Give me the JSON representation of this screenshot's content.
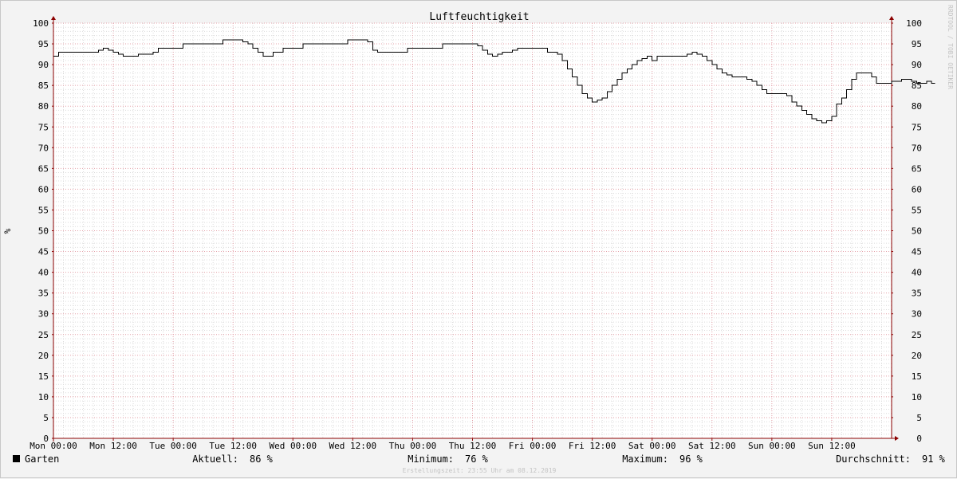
{
  "chart_data": {
    "type": "line",
    "title": "Luftfeuchtigkeit",
    "ylabel": "%",
    "ylim": [
      0,
      100
    ],
    "y_ticks": [
      0,
      5,
      10,
      15,
      20,
      25,
      30,
      35,
      40,
      45,
      50,
      55,
      60,
      65,
      70,
      75,
      80,
      85,
      90,
      95,
      100
    ],
    "x_ticks": [
      "Mon 00:00",
      "Mon 12:00",
      "Tue 00:00",
      "Tue 12:00",
      "Wed 00:00",
      "Wed 12:00",
      "Thu 00:00",
      "Thu 12:00",
      "Fri 00:00",
      "Fri 12:00",
      "Sat 00:00",
      "Sat 12:00",
      "Sun 00:00",
      "Sun 12:00"
    ],
    "xlim_hours": [
      0,
      168
    ],
    "grid": true,
    "line_style": "step",
    "watermark": "RRDTOOL / TOBI OETIKER",
    "series": [
      {
        "name": "Garten",
        "color": "#000000",
        "points": [
          [
            0,
            92
          ],
          [
            1,
            93
          ],
          [
            8,
            93
          ],
          [
            9,
            93.5
          ],
          [
            10,
            94
          ],
          [
            11,
            93.5
          ],
          [
            12,
            93
          ],
          [
            13,
            92.5
          ],
          [
            14,
            92
          ],
          [
            16,
            92
          ],
          [
            17,
            92.5
          ],
          [
            20,
            93
          ],
          [
            21,
            94
          ],
          [
            25,
            94
          ],
          [
            26,
            95
          ],
          [
            33,
            95
          ],
          [
            34,
            96
          ],
          [
            37,
            96
          ],
          [
            38,
            95.5
          ],
          [
            39,
            95
          ],
          [
            40,
            94
          ],
          [
            41,
            93
          ],
          [
            42,
            92
          ],
          [
            44,
            93
          ],
          [
            45,
            93
          ],
          [
            46,
            94
          ],
          [
            49,
            94
          ],
          [
            50,
            95
          ],
          [
            58,
            95
          ],
          [
            59,
            96
          ],
          [
            62,
            96
          ],
          [
            63,
            95.5
          ],
          [
            64,
            93.5
          ],
          [
            65,
            93
          ],
          [
            70,
            93
          ],
          [
            71,
            94
          ],
          [
            77,
            94
          ],
          [
            78,
            95
          ],
          [
            84,
            95
          ],
          [
            85,
            94.5
          ],
          [
            86,
            93.5
          ],
          [
            87,
            92.5
          ],
          [
            88,
            92
          ],
          [
            89,
            92.5
          ],
          [
            90,
            93
          ],
          [
            92,
            93.5
          ],
          [
            93,
            94
          ],
          [
            98,
            94
          ],
          [
            99,
            93
          ],
          [
            101,
            92.5
          ],
          [
            102,
            91
          ],
          [
            103,
            89
          ],
          [
            104,
            87
          ],
          [
            105,
            85
          ],
          [
            106,
            83
          ],
          [
            107,
            82
          ],
          [
            108,
            81
          ],
          [
            109,
            81.5
          ],
          [
            110,
            82
          ],
          [
            111,
            83.5
          ],
          [
            112,
            85
          ],
          [
            113,
            86.5
          ],
          [
            114,
            88
          ],
          [
            115,
            89
          ],
          [
            116,
            90
          ],
          [
            117,
            91
          ],
          [
            118,
            91.5
          ],
          [
            119,
            92
          ],
          [
            120,
            91
          ],
          [
            121,
            92
          ],
          [
            126,
            92
          ],
          [
            127,
            92.5
          ],
          [
            128,
            93
          ],
          [
            129,
            92.5
          ],
          [
            130,
            92
          ],
          [
            131,
            91
          ],
          [
            132,
            90
          ],
          [
            133,
            89
          ],
          [
            134,
            88
          ],
          [
            135,
            87.5
          ],
          [
            136,
            87
          ],
          [
            138,
            87
          ],
          [
            139,
            86.5
          ],
          [
            140,
            86
          ],
          [
            141,
            85
          ],
          [
            142,
            84
          ],
          [
            143,
            83
          ],
          [
            146,
            83
          ],
          [
            147,
            82.5
          ],
          [
            148,
            81
          ],
          [
            149,
            80
          ],
          [
            150,
            79
          ],
          [
            151,
            78
          ],
          [
            152,
            77
          ],
          [
            153,
            76.5
          ],
          [
            154,
            76
          ],
          [
            155,
            76.5
          ],
          [
            156,
            77.5
          ],
          [
            157,
            80.5
          ],
          [
            158,
            82
          ],
          [
            159,
            84
          ],
          [
            160,
            86.5
          ],
          [
            161,
            88
          ],
          [
            163,
            88
          ],
          [
            164,
            87
          ],
          [
            165,
            85.5
          ],
          [
            167,
            85.5
          ],
          [
            168,
            86
          ],
          [
            170,
            86.5
          ],
          [
            172,
            86
          ],
          [
            173,
            85.5
          ],
          [
            174,
            85.5
          ],
          [
            175,
            86
          ],
          [
            176,
            85.5
          ],
          [
            176.7,
            85.5
          ]
        ]
      }
    ]
  },
  "legend": {
    "series_name": "Garten",
    "current_label": "Aktuell:",
    "current_value": "86 %",
    "min_label": "Minimum:",
    "min_value": "76 %",
    "max_label": "Maximum:",
    "max_value": "96 %",
    "avg_label": "Durchschnitt:",
    "avg_value": "91 %",
    "timestamp": "Erstellungszeit: 23:55 Uhr am 08.12.2019"
  },
  "colors": {
    "background": "#f3f3f3",
    "plot_area": "#ffffff",
    "grid_minor": "#dcdcdc",
    "grid_major": "#e3a0a8",
    "axis": "#8b0000",
    "line": "#000000"
  }
}
